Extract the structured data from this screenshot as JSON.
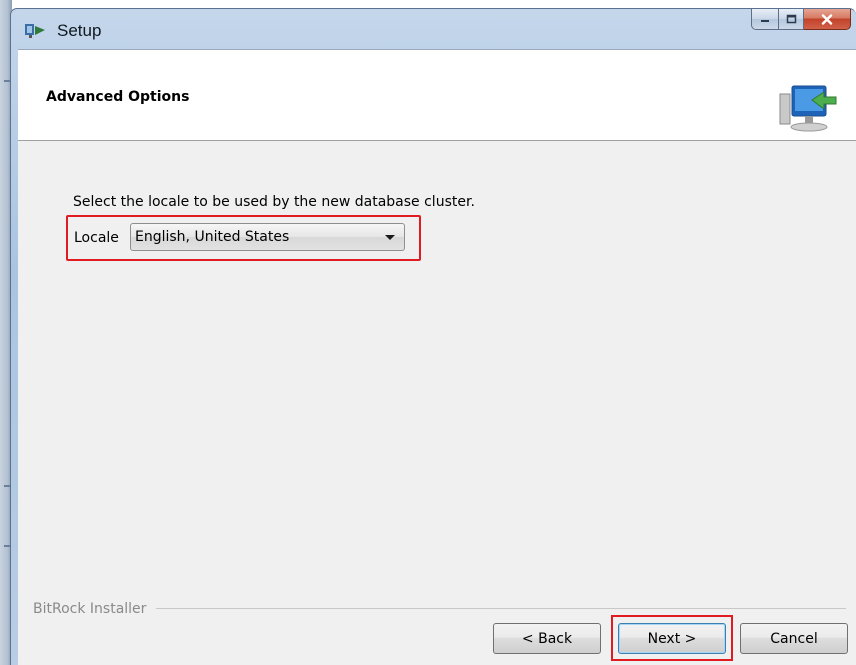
{
  "window": {
    "title": "Setup",
    "controls": {
      "minimize": "minimize-icon",
      "maximize": "maximize-icon",
      "close": "close-icon"
    }
  },
  "header": {
    "title": "Advanced Options",
    "icon": "computer-install-icon"
  },
  "body": {
    "prompt": "Select the locale to be used by the new database cluster.",
    "locale": {
      "label": "Locale",
      "selected": "English, United States"
    }
  },
  "footer": {
    "brand": "BitRock Installer",
    "buttons": {
      "back": "< Back",
      "next": "Next >",
      "cancel": "Cancel"
    }
  },
  "colors": {
    "highlight": "#e11b22",
    "titlebar": "#aac4e0",
    "close_button": "#c2432a"
  }
}
